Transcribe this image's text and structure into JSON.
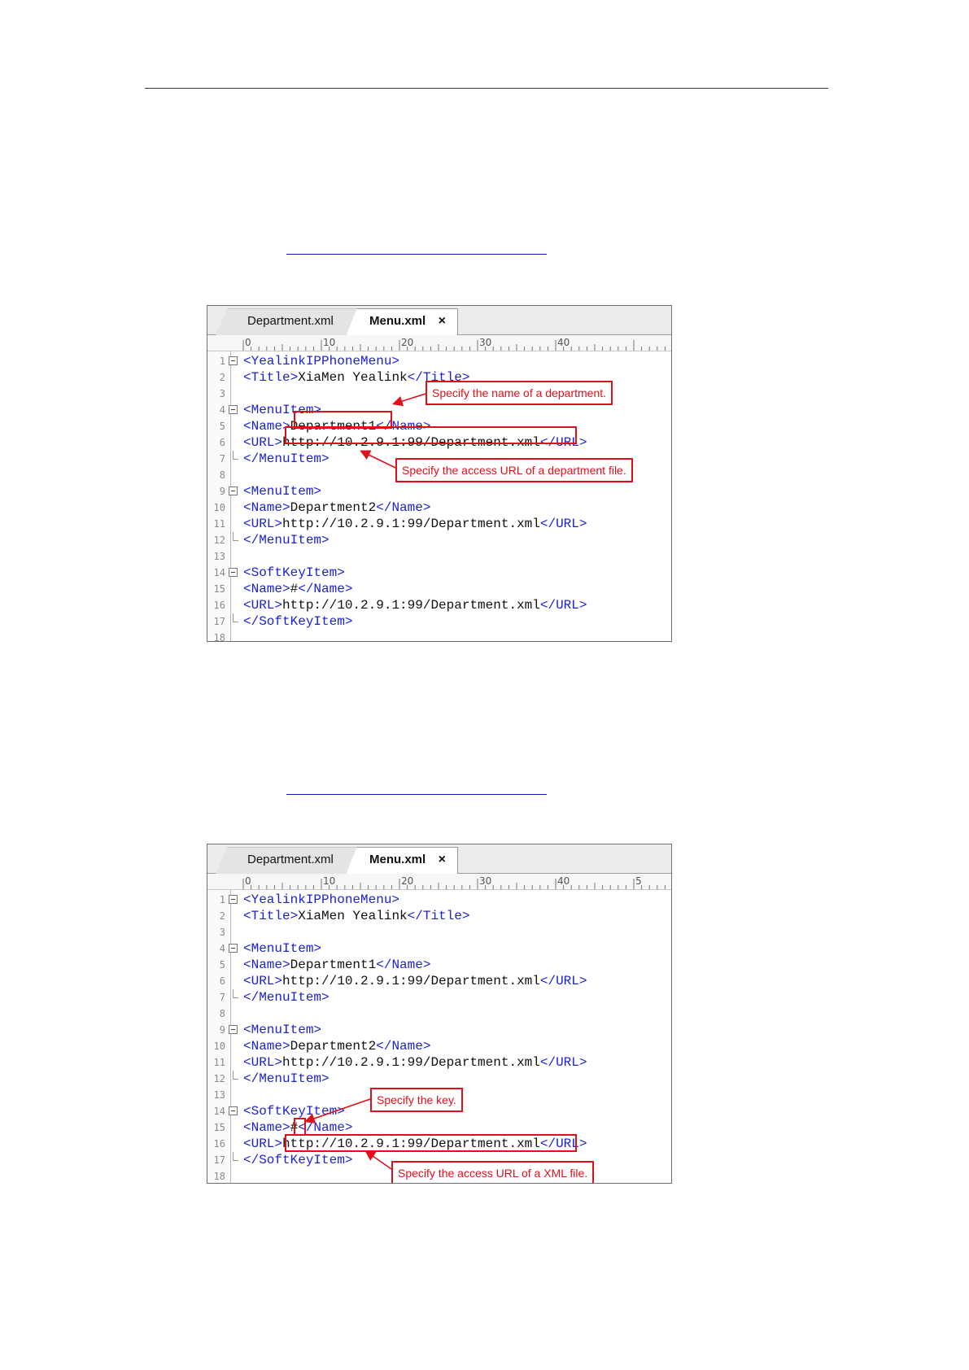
{
  "screenshot_1": {
    "tabs": [
      {
        "label": "Department.xml"
      },
      {
        "label": "Menu.xml",
        "close": "×"
      }
    ],
    "ruler": [
      "0",
      "10",
      "20",
      "30",
      "40"
    ],
    "lines": [
      {
        "n": "1",
        "fold": "start",
        "parts": [
          {
            "t": "<YealinkIPPhoneMenu>",
            "tag": true
          }
        ]
      },
      {
        "n": "2",
        "fold": "",
        "parts": [
          {
            "t": "<Title>",
            "tag": true
          },
          {
            "t": "XiaMen Yealink",
            "tag": false
          },
          {
            "t": "</Title>",
            "tag": true
          }
        ]
      },
      {
        "n": "3",
        "fold": "",
        "parts": []
      },
      {
        "n": "4",
        "fold": "start",
        "parts": [
          {
            "t": "<MenuItem>",
            "tag": true
          }
        ]
      },
      {
        "n": "5",
        "fold": "",
        "parts": [
          {
            "t": "<Name>",
            "tag": true
          },
          {
            "t": "Department1",
            "tag": false
          },
          {
            "t": "</Name>",
            "tag": true
          }
        ]
      },
      {
        "n": "6",
        "fold": "",
        "parts": [
          {
            "t": "<URL>",
            "tag": true
          },
          {
            "t": "http://10.2.9.1:99/Department.xml",
            "tag": false
          },
          {
            "t": "</URL>",
            "tag": true
          }
        ]
      },
      {
        "n": "7",
        "fold": "end",
        "parts": [
          {
            "t": "</MenuItem>",
            "tag": true
          }
        ]
      },
      {
        "n": "8",
        "fold": "",
        "parts": []
      },
      {
        "n": "9",
        "fold": "start",
        "parts": [
          {
            "t": "<MenuItem>",
            "tag": true
          }
        ]
      },
      {
        "n": "10",
        "fold": "",
        "parts": [
          {
            "t": "<Name>",
            "tag": true
          },
          {
            "t": "Department2",
            "tag": false
          },
          {
            "t": "</Name>",
            "tag": true
          }
        ]
      },
      {
        "n": "11",
        "fold": "",
        "parts": [
          {
            "t": "<URL>",
            "tag": true
          },
          {
            "t": "http://10.2.9.1:99/Department.xml",
            "tag": false
          },
          {
            "t": "</URL>",
            "tag": true
          }
        ]
      },
      {
        "n": "12",
        "fold": "end",
        "parts": [
          {
            "t": "</MenuItem>",
            "tag": true
          }
        ]
      },
      {
        "n": "13",
        "fold": "",
        "parts": []
      },
      {
        "n": "14",
        "fold": "start",
        "parts": [
          {
            "t": "<SoftKeyItem>",
            "tag": true
          }
        ]
      },
      {
        "n": "15",
        "fold": "",
        "parts": [
          {
            "t": "<Name>",
            "tag": true
          },
          {
            "t": "#",
            "tag": false
          },
          {
            "t": "</Name>",
            "tag": true
          }
        ]
      },
      {
        "n": "16",
        "fold": "",
        "parts": [
          {
            "t": "<URL>",
            "tag": true
          },
          {
            "t": "http://10.2.9.1:99/Department.xml",
            "tag": false
          },
          {
            "t": "</URL>",
            "tag": true
          }
        ]
      },
      {
        "n": "17",
        "fold": "end",
        "parts": [
          {
            "t": "</SoftKeyItem>",
            "tag": true
          }
        ]
      },
      {
        "n": "18",
        "fold": "",
        "parts": []
      }
    ],
    "callouts": [
      {
        "text": "Specify the name of a department."
      },
      {
        "text": "Specify the access URL of a department file."
      }
    ]
  },
  "screenshot_2": {
    "tabs": [
      {
        "label": "Department.xml"
      },
      {
        "label": "Menu.xml",
        "close": "×"
      }
    ],
    "ruler": [
      "0",
      "10",
      "20",
      "30",
      "40",
      "5"
    ],
    "lines": [
      {
        "n": "1",
        "fold": "start",
        "parts": [
          {
            "t": "<YealinkIPPhoneMenu>",
            "tag": true
          }
        ]
      },
      {
        "n": "2",
        "fold": "",
        "parts": [
          {
            "t": "<Title>",
            "tag": true
          },
          {
            "t": "XiaMen Yealink",
            "tag": false
          },
          {
            "t": "</Title>",
            "tag": true
          }
        ]
      },
      {
        "n": "3",
        "fold": "",
        "parts": []
      },
      {
        "n": "4",
        "fold": "start",
        "parts": [
          {
            "t": "<MenuItem>",
            "tag": true
          }
        ]
      },
      {
        "n": "5",
        "fold": "",
        "parts": [
          {
            "t": "<Name>",
            "tag": true
          },
          {
            "t": "Department1",
            "tag": false
          },
          {
            "t": "</Name>",
            "tag": true
          }
        ]
      },
      {
        "n": "6",
        "fold": "",
        "parts": [
          {
            "t": "<URL>",
            "tag": true
          },
          {
            "t": "http://10.2.9.1:99/Department.xml",
            "tag": false
          },
          {
            "t": "</URL>",
            "tag": true
          }
        ]
      },
      {
        "n": "7",
        "fold": "end",
        "parts": [
          {
            "t": "</MenuItem>",
            "tag": true
          }
        ]
      },
      {
        "n": "8",
        "fold": "",
        "parts": []
      },
      {
        "n": "9",
        "fold": "start",
        "parts": [
          {
            "t": "<MenuItem>",
            "tag": true
          }
        ]
      },
      {
        "n": "10",
        "fold": "",
        "parts": [
          {
            "t": "<Name>",
            "tag": true
          },
          {
            "t": "Department2",
            "tag": false
          },
          {
            "t": "</Name>",
            "tag": true
          }
        ]
      },
      {
        "n": "11",
        "fold": "",
        "parts": [
          {
            "t": "<URL>",
            "tag": true
          },
          {
            "t": "http://10.2.9.1:99/Department.xml",
            "tag": false
          },
          {
            "t": "</URL>",
            "tag": true
          }
        ]
      },
      {
        "n": "12",
        "fold": "end",
        "parts": [
          {
            "t": "</MenuItem>",
            "tag": true
          }
        ]
      },
      {
        "n": "13",
        "fold": "",
        "parts": []
      },
      {
        "n": "14",
        "fold": "start",
        "parts": [
          {
            "t": "<SoftKeyItem>",
            "tag": true
          }
        ]
      },
      {
        "n": "15",
        "fold": "",
        "parts": [
          {
            "t": "<Name>",
            "tag": true
          },
          {
            "t": "#",
            "tag": false
          },
          {
            "t": "</Name>",
            "tag": true
          }
        ]
      },
      {
        "n": "16",
        "fold": "",
        "parts": [
          {
            "t": "<URL>",
            "tag": true
          },
          {
            "t": "http://10.2.9.1:99/Department.xml",
            "tag": false
          },
          {
            "t": "</URL>",
            "tag": true
          }
        ]
      },
      {
        "n": "17",
        "fold": "end",
        "parts": [
          {
            "t": "</SoftKeyItem>",
            "tag": true
          }
        ]
      },
      {
        "n": "18",
        "fold": "",
        "parts": []
      }
    ],
    "callouts": [
      {
        "text": "Specify the key."
      },
      {
        "text": "Specify the access URL of a XML file."
      }
    ]
  }
}
